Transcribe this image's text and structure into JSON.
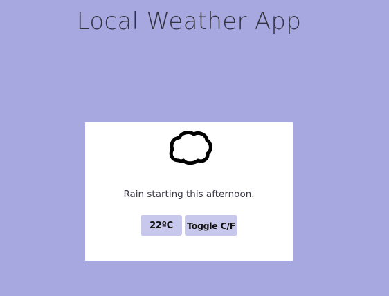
{
  "app": {
    "title": "Local Weather App"
  },
  "weather": {
    "icon": "cloud-icon",
    "description": "Rain starting this afternoon.",
    "temperature": "22ºC"
  },
  "controls": {
    "toggle_label": "Toggle C/F"
  },
  "colors": {
    "background": "#a8a8e0",
    "card": "#ffffff",
    "button": "#c8c8ec"
  }
}
